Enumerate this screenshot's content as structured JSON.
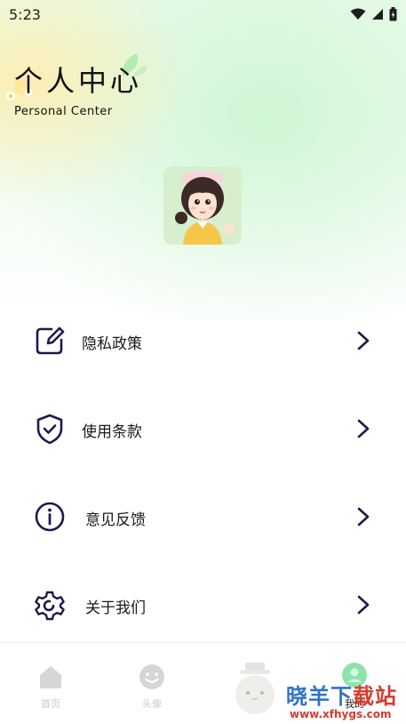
{
  "status_bar": {
    "time": "5:23",
    "icons": [
      "wifi-icon",
      "signal-icon",
      "battery-icon"
    ]
  },
  "header": {
    "title": "个人中心",
    "subtitle": "Personal Center"
  },
  "profile": {
    "avatar": "avatar-illustration"
  },
  "menu": [
    {
      "label": "隐私政策",
      "icon": "edit-icon"
    },
    {
      "label": "使用条款",
      "icon": "shield-check-icon"
    },
    {
      "label": "意见反馈",
      "icon": "info-icon"
    },
    {
      "label": "关于我们",
      "icon": "gear-icon"
    }
  ],
  "tabs": [
    {
      "label": "首页",
      "icon": "home-icon",
      "active": false
    },
    {
      "label": "头像",
      "icon": "smiley-icon",
      "active": false
    },
    {
      "label": "",
      "icon": "center-mascot-icon",
      "active": false
    },
    {
      "label": "我的",
      "icon": "profile-icon",
      "active": true
    }
  ],
  "watermark": {
    "text_cn_blue": "晓羊下",
    "text_cn_red": "载站",
    "url": "www.xfhygs.com"
  },
  "colors": {
    "icon_stroke": "#1c1b4d",
    "accent_green": "#6fd58f",
    "tab_inactive": "#c9c9c9"
  }
}
